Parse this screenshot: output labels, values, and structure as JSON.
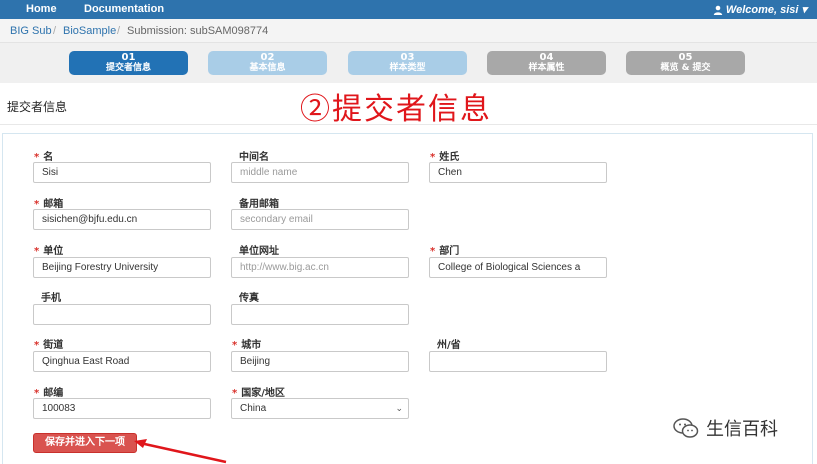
{
  "nav": {
    "home": "Home",
    "docs": "Documentation",
    "user": "Welcome, sisi",
    "user_caret": "▾"
  },
  "breadcrumb": {
    "root": "BIG Sub",
    "sep": "/",
    "sub": "BioSample",
    "current": "Submission: subSAM098774"
  },
  "steps": [
    {
      "num": "01",
      "label": "提交者信息",
      "state": "active"
    },
    {
      "num": "02",
      "label": "基本信息",
      "state": "next"
    },
    {
      "num": "03",
      "label": "样本类型",
      "state": "next"
    },
    {
      "num": "04",
      "label": "样本属性",
      "state": "later"
    },
    {
      "num": "05",
      "label": "概览 & 提交",
      "state": "later"
    }
  ],
  "section_title": "提交者信息",
  "annotation": "②提交者信息",
  "required_mark": "*",
  "form": {
    "first_name": {
      "label": "名",
      "value": "Sisi"
    },
    "middle_name": {
      "label": "中间名",
      "placeholder": "middle name"
    },
    "last_name": {
      "label": "姓氏",
      "value": "Chen"
    },
    "email": {
      "label": "邮箱",
      "value": "sisichen@bjfu.edu.cn"
    },
    "secondary_email": {
      "label": "备用邮箱",
      "placeholder": "secondary email"
    },
    "organization": {
      "label": "单位",
      "value": "Beijing Forestry University"
    },
    "org_url": {
      "label": "单位网址",
      "placeholder": "http://www.big.ac.cn"
    },
    "department": {
      "label": "部门",
      "value": "College of Biological Sciences a"
    },
    "mobile": {
      "label": "手机",
      "value": ""
    },
    "fax": {
      "label": "传真",
      "value": ""
    },
    "street": {
      "label": "街道",
      "value": "Qinghua East Road"
    },
    "city": {
      "label": "城市",
      "value": "Beijing"
    },
    "province": {
      "label": "州/省",
      "value": ""
    },
    "postcode": {
      "label": "邮编",
      "value": "100083"
    },
    "country": {
      "label": "国家/地区",
      "value": "China",
      "options": [
        "China"
      ]
    }
  },
  "save_button": "保存并进入下一项",
  "watermark": "生信百科",
  "colors": {
    "nav": "#2e73ad",
    "active_step": "#2272b5",
    "next_step": "#a9cde7",
    "later_step": "#a8a8a8",
    "required": "#d9312b",
    "save_button": "#d9534f",
    "annotation": "#e0161b"
  }
}
